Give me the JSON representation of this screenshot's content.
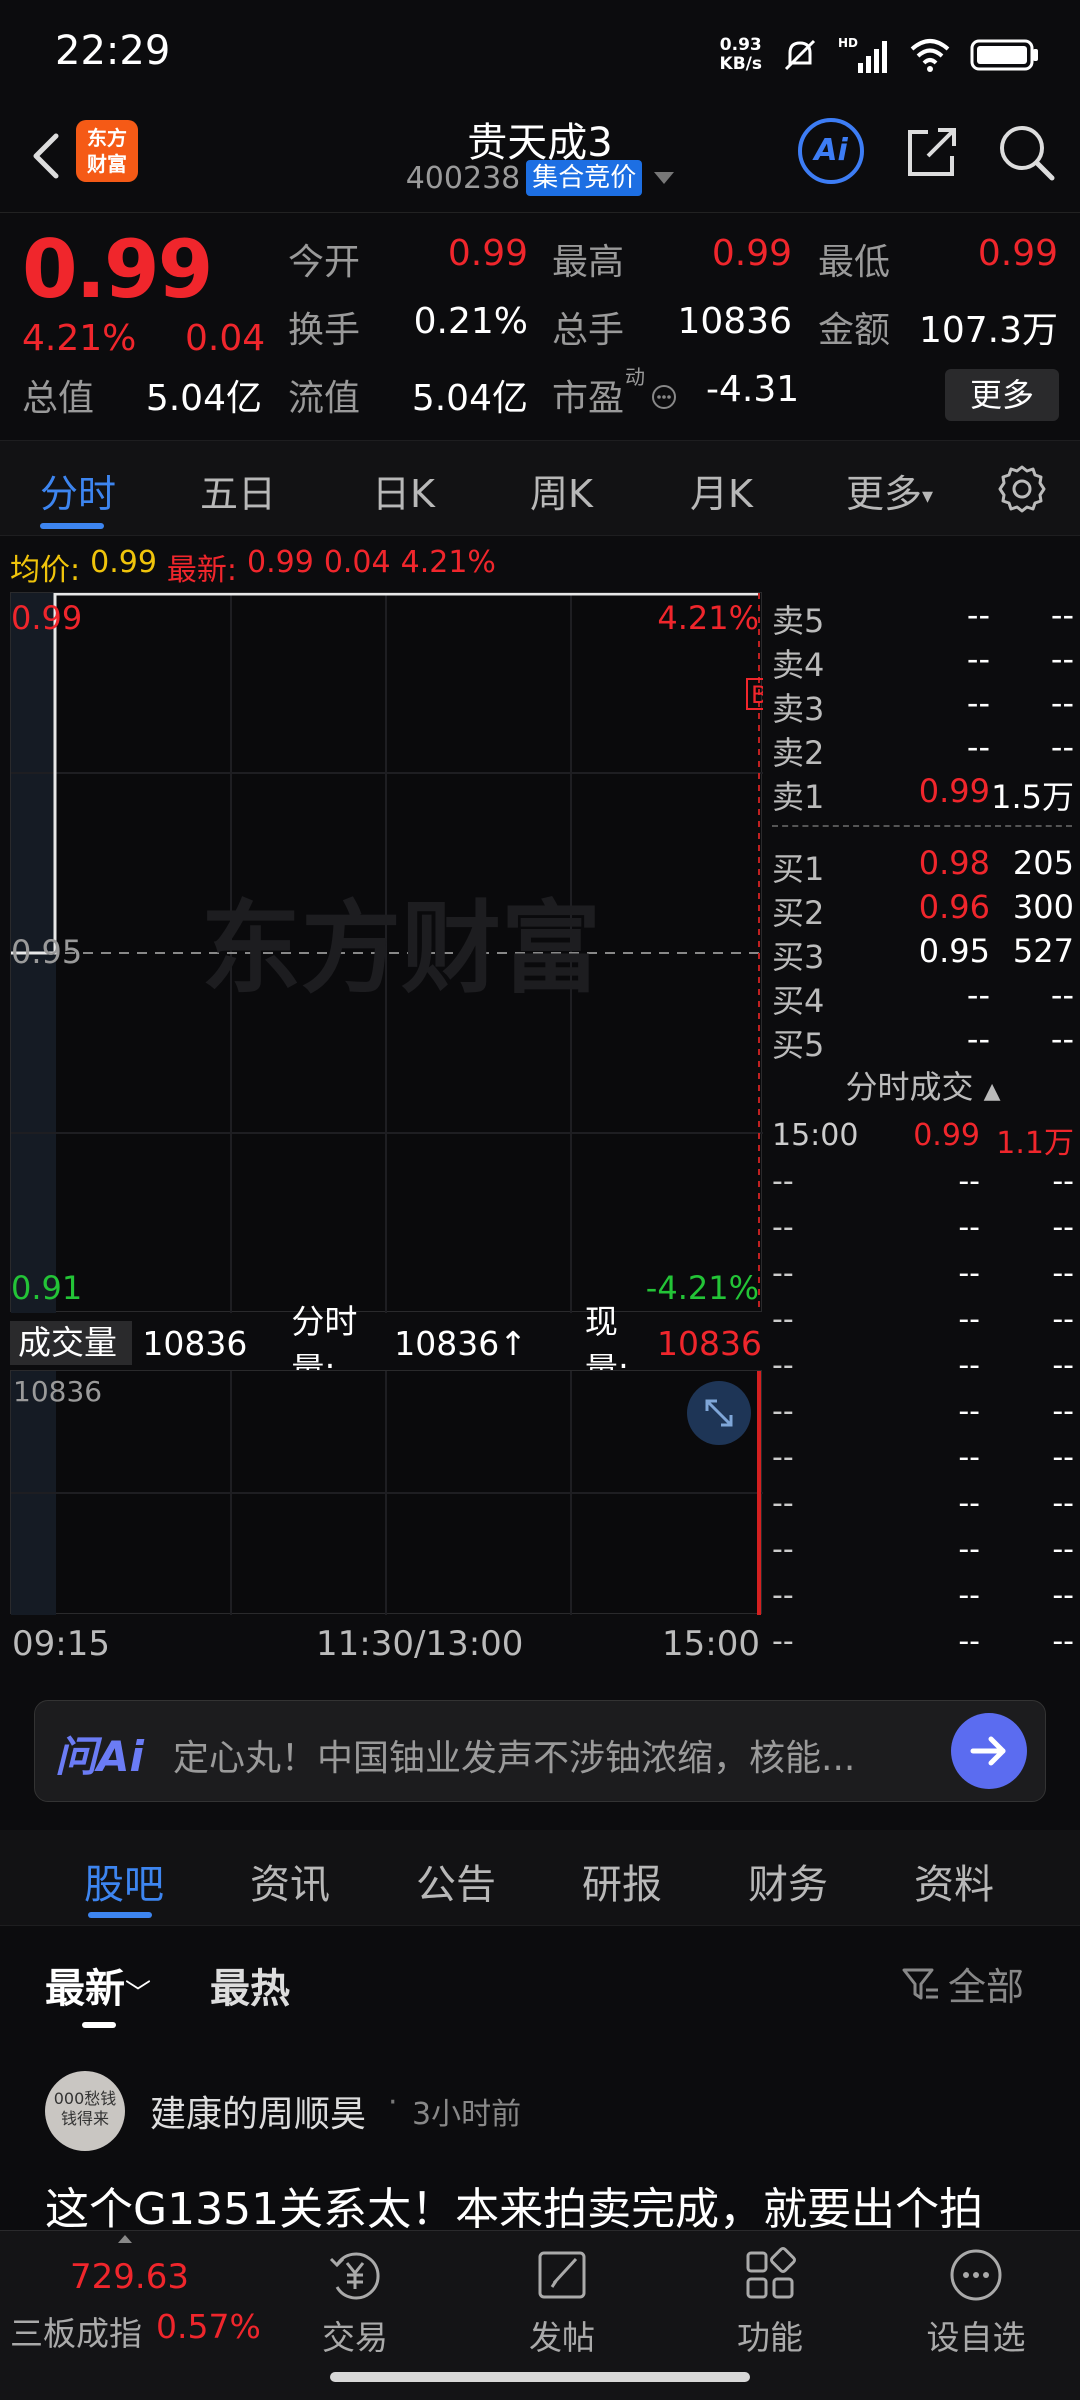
{
  "status_bar": {
    "time": "22:29",
    "net_speed_value": "0.93",
    "net_speed_unit": "KB/s",
    "hd_label": "HD"
  },
  "header": {
    "logo_line1": "东方",
    "logo_line2": "财富",
    "stock_name": "贵天成3",
    "stock_code": "400238",
    "auction_badge": "集合竞价",
    "ai_label": "Ai"
  },
  "quote": {
    "price": "0.99",
    "change_pct": "4.21%",
    "change_amt": "0.04",
    "more_label": "更多",
    "fields": [
      {
        "label": "今开",
        "value": "0.99",
        "color": "red"
      },
      {
        "label": "最高",
        "value": "0.99",
        "color": "red"
      },
      {
        "label": "最低",
        "value": "0.99",
        "color": "red"
      },
      {
        "label": "换手",
        "value": "0.21%",
        "color": "white"
      },
      {
        "label": "总手",
        "value": "10836",
        "color": "white"
      },
      {
        "label": "金额",
        "value": "107.3万",
        "color": "white"
      },
      {
        "label": "总值",
        "value": "5.04亿",
        "color": "white"
      },
      {
        "label": "流值",
        "value": "5.04亿",
        "color": "white"
      },
      {
        "label": "市盈",
        "value": "-4.31",
        "color": "white"
      }
    ],
    "pe_superscript": "动"
  },
  "chart_tabs": [
    {
      "label": "分时",
      "active": true
    },
    {
      "label": "五日",
      "active": false
    },
    {
      "label": "日K",
      "active": false
    },
    {
      "label": "周K",
      "active": false
    },
    {
      "label": "月K",
      "active": false
    },
    {
      "label": "更多",
      "active": false
    }
  ],
  "info_strip": {
    "avg_label": "均价:",
    "avg_value": "0.99",
    "latest_label": "最新:",
    "latest_value": "0.99",
    "latest_change": "0.04",
    "latest_pct": "4.21%"
  },
  "price_chart": {
    "y_top": "0.99",
    "y_mid": "0.95",
    "y_bottom": "0.91",
    "pct_top": "4.21%",
    "pct_bottom": "-4.21%",
    "watermark": "东方财富",
    "marker": "B"
  },
  "chart_data": {
    "type": "line",
    "x": [
      "09:15",
      "09:30",
      "15:00"
    ],
    "values": [
      0.95,
      0.99,
      0.99
    ],
    "ylim": [
      0.91,
      0.99
    ],
    "prev_close": 0.95
  },
  "volume": {
    "dropdown_label": "成交量",
    "total": "10836",
    "period_label": "分时量:",
    "period_value": "10836↑",
    "current_label": "现量:",
    "current_value": "10836",
    "axis_max": "10836"
  },
  "time_axis": {
    "start": "09:15",
    "mid": "11:30/13:00",
    "end": "15:00"
  },
  "orderbook": {
    "asks": [
      {
        "label": "卖5",
        "price": "--",
        "vol": "--",
        "color": "white"
      },
      {
        "label": "卖4",
        "price": "--",
        "vol": "--",
        "color": "white"
      },
      {
        "label": "卖3",
        "price": "--",
        "vol": "--",
        "color": "white"
      },
      {
        "label": "卖2",
        "price": "--",
        "vol": "--",
        "color": "white"
      },
      {
        "label": "卖1",
        "price": "0.99",
        "vol": "1.5万",
        "color": "red"
      }
    ],
    "bids": [
      {
        "label": "买1",
        "price": "0.98",
        "vol": "205",
        "color": "red"
      },
      {
        "label": "买2",
        "price": "0.96",
        "vol": "300",
        "color": "red"
      },
      {
        "label": "买3",
        "price": "0.95",
        "vol": "527",
        "color": "white"
      },
      {
        "label": "买4",
        "price": "--",
        "vol": "--",
        "color": "white"
      },
      {
        "label": "买5",
        "price": "--",
        "vol": "--",
        "color": "white"
      }
    ],
    "trades_title": "分时成交",
    "trades": [
      {
        "time": "15:00",
        "price": "0.99",
        "vol": "1.1万",
        "color": "red"
      },
      {
        "time": "--",
        "price": "--",
        "vol": "--",
        "color": "white"
      },
      {
        "time": "--",
        "price": "--",
        "vol": "--",
        "color": "white"
      },
      {
        "time": "--",
        "price": "--",
        "vol": "--",
        "color": "white"
      },
      {
        "time": "--",
        "price": "--",
        "vol": "--",
        "color": "white"
      },
      {
        "time": "--",
        "price": "--",
        "vol": "--",
        "color": "white"
      },
      {
        "time": "--",
        "price": "--",
        "vol": "--",
        "color": "white"
      },
      {
        "time": "--",
        "price": "--",
        "vol": "--",
        "color": "white"
      },
      {
        "time": "--",
        "price": "--",
        "vol": "--",
        "color": "white"
      },
      {
        "time": "--",
        "price": "--",
        "vol": "--",
        "color": "white"
      },
      {
        "time": "--",
        "price": "--",
        "vol": "--",
        "color": "white"
      },
      {
        "time": "--",
        "price": "--",
        "vol": "--",
        "color": "white"
      }
    ]
  },
  "ai_bar": {
    "logo": "问Ai",
    "text": "定心丸！中国铀业发声不涉铀浓缩，核能..."
  },
  "section_tabs": [
    {
      "label": "股吧",
      "active": true
    },
    {
      "label": "资讯",
      "active": false
    },
    {
      "label": "公告",
      "active": false
    },
    {
      "label": "研报",
      "active": false
    },
    {
      "label": "财务",
      "active": false
    },
    {
      "label": "资料",
      "active": false
    }
  ],
  "filter": {
    "newest": "最新",
    "hot": "最热",
    "all": "全部"
  },
  "post": {
    "avatar_text": "000愁钱 钱得来",
    "author": "建康的周顺昊",
    "dot": "·",
    "time": "3小时前",
    "text": "这个G1351关系太！本来拍卖完成，就要出个拍"
  },
  "bottom_nav": {
    "index_value": "729.63",
    "index_name": "三板成指",
    "index_pct": "0.57%",
    "items": [
      {
        "label": "交易",
        "icon": "yuan-trade-icon"
      },
      {
        "label": "发帖",
        "icon": "edit-post-icon"
      },
      {
        "label": "功能",
        "icon": "grid-apps-icon"
      },
      {
        "label": "设自选",
        "icon": "more-dots-icon"
      }
    ]
  }
}
